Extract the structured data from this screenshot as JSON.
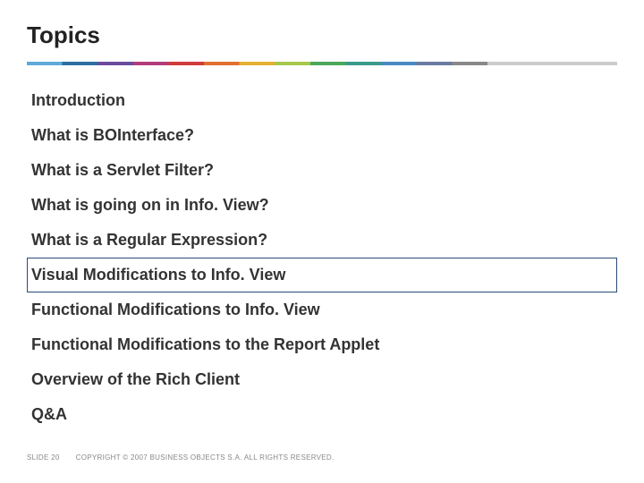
{
  "title": "Topics",
  "topics": [
    {
      "label": "Introduction",
      "highlight": false
    },
    {
      "label": "What is BOInterface?",
      "highlight": false
    },
    {
      "label": "What is a Servlet Filter?",
      "highlight": false
    },
    {
      "label": "What is going on in Info. View?",
      "highlight": false
    },
    {
      "label": "What is a Regular Expression?",
      "highlight": false
    },
    {
      "label": "Visual Modifications to Info. View",
      "highlight": true
    },
    {
      "label": "Functional Modifications to Info. View",
      "highlight": false
    },
    {
      "label": "Functional Modifications to the Report Applet",
      "highlight": false
    },
    {
      "label": "Overview of the Rich Client",
      "highlight": false
    },
    {
      "label": "Q&A",
      "highlight": false
    }
  ],
  "footer": {
    "slide": "SLIDE 20",
    "copyright": "COPYRIGHT © 2007 BUSINESS OBJECTS S.A.  ALL RIGHTS RESERVED."
  }
}
